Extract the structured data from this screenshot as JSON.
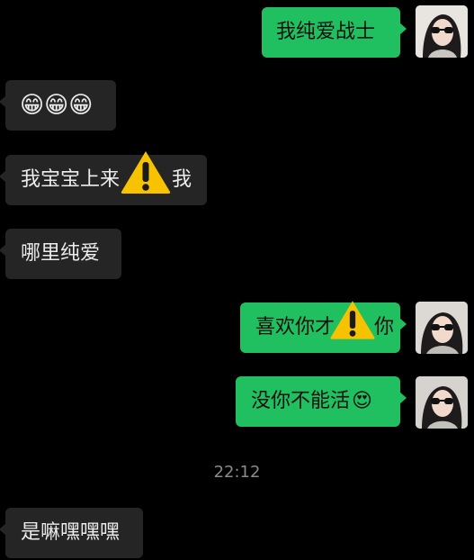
{
  "messages": [
    {
      "side": "out",
      "text": "我纯爱战士"
    },
    {
      "side": "in",
      "emoji": "😁😁😁"
    },
    {
      "side": "in",
      "text": "我宝宝上来",
      "text_after": "我"
    },
    {
      "side": "in",
      "text": "哪里纯爱"
    },
    {
      "side": "out",
      "text": "喜欢你才",
      "text_after": "你"
    },
    {
      "side": "out",
      "text": "没你不能活",
      "emoji": "😍"
    },
    {
      "side": "in",
      "text": "是嘛嘿嘿嘿"
    }
  ],
  "timestamp": "22:12",
  "icons": {
    "warning": "warning-triangle-icon",
    "avatar": "user-avatar-photo"
  },
  "colors": {
    "background": "#000000",
    "incoming_bubble": "#252525",
    "outgoing_bubble": "#20c061",
    "warning": "#f7c200"
  }
}
